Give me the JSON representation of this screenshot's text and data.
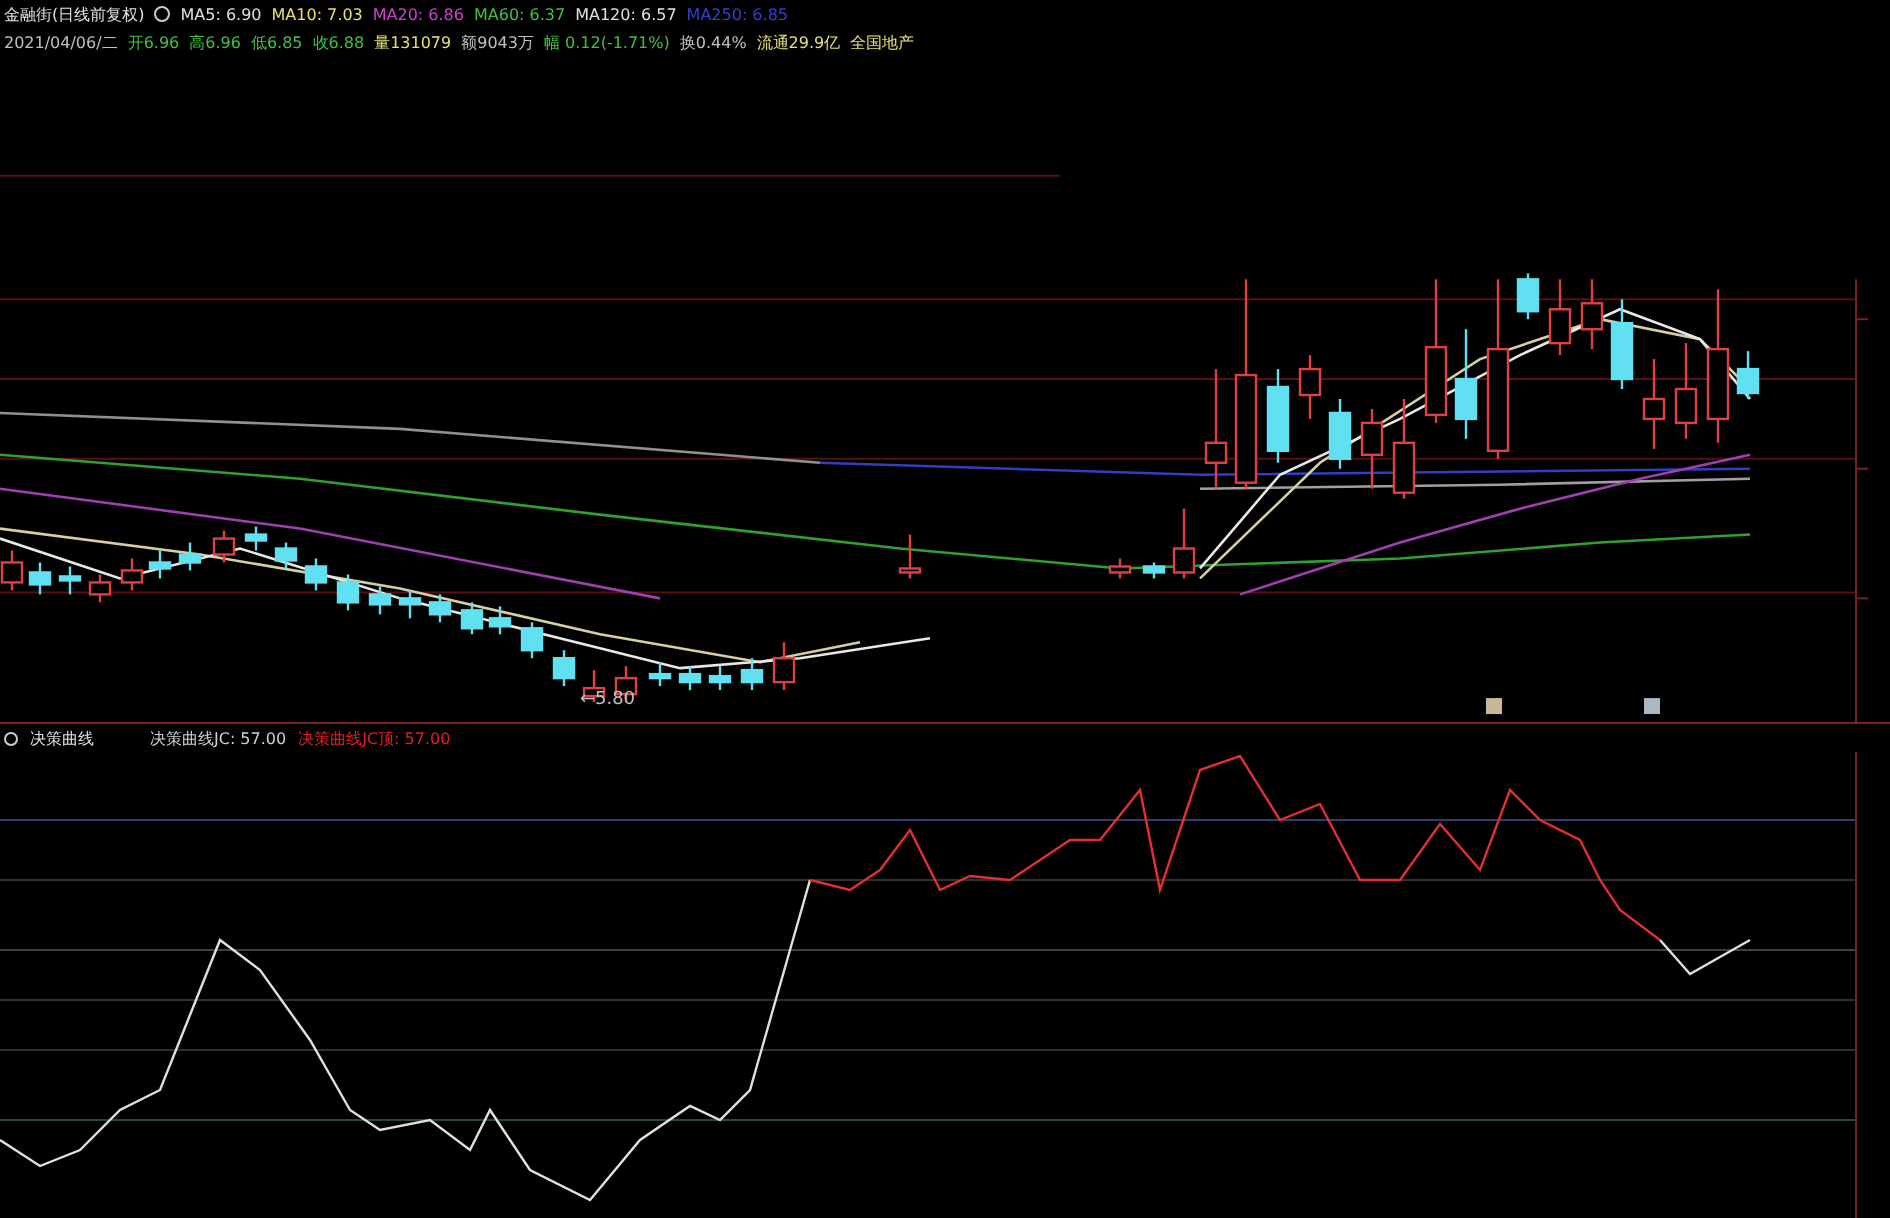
{
  "header": {
    "title": "金融街(日线前复权)",
    "ma_values": [
      {
        "label": "MA5: 6.90",
        "color": "#e0e0e0"
      },
      {
        "label": "MA10: 7.03",
        "color": "#e8e070"
      },
      {
        "label": "MA20: 6.86",
        "color": "#d040d0"
      },
      {
        "label": "MA60: 6.37",
        "color": "#40c040"
      },
      {
        "label": "MA120: 6.57",
        "color": "#e0e0e0"
      },
      {
        "label": "MA250: 6.85",
        "color": "#3040d0"
      }
    ],
    "quote": [
      {
        "label": "2021/04/06/二",
        "color": "#c0c0c0"
      },
      {
        "label": "开6.96",
        "color": "#40c040"
      },
      {
        "label": "高6.96",
        "color": "#40c040"
      },
      {
        "label": "低6.85",
        "color": "#40c040"
      },
      {
        "label": "收6.88",
        "color": "#40c040"
      },
      {
        "label": "量131079",
        "color": "#e8e070"
      },
      {
        "label": "额9043万",
        "color": "#c0c0c0"
      },
      {
        "label": "幅 0.12(-1.71%)",
        "color": "#40c040"
      },
      {
        "label": "换0.44%",
        "color": "#c0c0c0"
      },
      {
        "label": "流通29.9亿",
        "color": "#e8e070"
      },
      {
        "label": "全国地产",
        "color": "#e8e070"
      }
    ]
  },
  "price_panel": {
    "low_label": "←5.80"
  },
  "indicator_panel": {
    "title": "决策曲线",
    "readings": [
      {
        "label": "决策曲线JC: 57.00",
        "color": "#d0d0d0"
      },
      {
        "label": "决策曲线JC顶: 57.00",
        "color": "#e02020"
      }
    ]
  }
}
